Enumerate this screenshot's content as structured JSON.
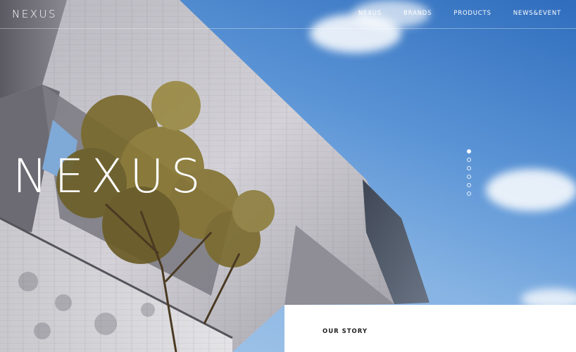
{
  "header": {
    "logo": "NEXUS",
    "nav": [
      {
        "label": "NEXUS"
      },
      {
        "label": "BRANDS"
      },
      {
        "label": "PRODUCTS"
      },
      {
        "label": "NEWS&EVENT"
      }
    ]
  },
  "hero": {
    "big_logo": "NEXUS",
    "slides_total": 6,
    "active_slide": 1
  },
  "story": {
    "title": "OUR STORY"
  },
  "colors": {
    "sky_top": "#2f6dbd",
    "sky_bottom": "#a9c9ea",
    "text": "#ffffff",
    "panel": "#ffffff"
  }
}
